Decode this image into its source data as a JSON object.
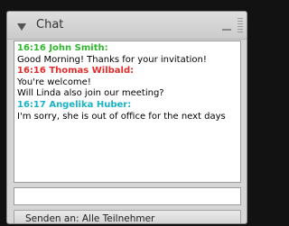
{
  "chat": {
    "title": "Chat",
    "messages": [
      {
        "time": "16:16",
        "author": "John Smith:",
        "color": "#2eb82e",
        "lines": [
          "Good Morning! Thanks for your invitation!"
        ]
      },
      {
        "time": "16:16",
        "author": "Thomas Wilbald:",
        "color": "#e22b2b",
        "lines": [
          "You're welcome!",
          "Will Linda also join our meeting?"
        ]
      },
      {
        "time": "16:17",
        "author": "Angelika Huber:",
        "color": "#19b3c4",
        "lines": [
          "I'm sorry, she is out of office for the next days"
        ]
      }
    ],
    "input_value": "",
    "send_to_label": "Senden an: Alle Teilnehmer"
  },
  "icons": {
    "collapse": "triangle-down-icon",
    "minimize": "minimize-icon",
    "dropdown": "chevron-down-icon"
  }
}
